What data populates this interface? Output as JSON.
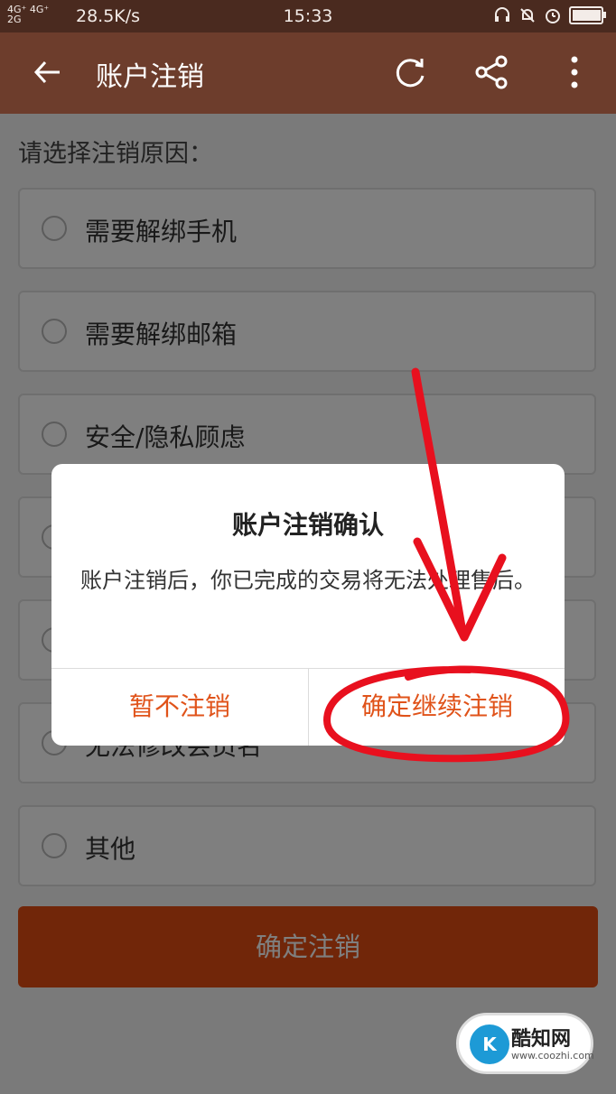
{
  "status_bar": {
    "network": "4G⁺ 4G⁺\n2G",
    "speed": "28.5K/s",
    "time": "15:33",
    "battery_level": 0.9
  },
  "app_bar": {
    "title": "账户注销",
    "back_icon": "arrow-left-icon",
    "refresh_icon": "refresh-icon",
    "share_icon": "share-icon",
    "more_icon": "more-vertical-icon"
  },
  "form": {
    "prompt": "请选择注销原因：",
    "options": [
      {
        "label": "需要解绑手机"
      },
      {
        "label": "需要解绑邮箱"
      },
      {
        "label": "安全/隐私顾虑"
      },
      {
        "label": ""
      },
      {
        "label": ""
      },
      {
        "label": "无法修改会员名"
      },
      {
        "label": "其他"
      }
    ],
    "submit_label": "确定注销"
  },
  "dialog": {
    "title": "账户注销确认",
    "message": "账户注销后，你已完成的交易将无法处理售后。",
    "cancel_label": "暂不注销",
    "confirm_label": "确定继续注销"
  },
  "watermark": {
    "name": "酷知网",
    "url": "www.coozhi.com"
  },
  "colors": {
    "status_bar": "#4a2a1f",
    "app_bar": "#6d3d2c",
    "accent": "#e0531a",
    "annotation": "#e8101e"
  }
}
